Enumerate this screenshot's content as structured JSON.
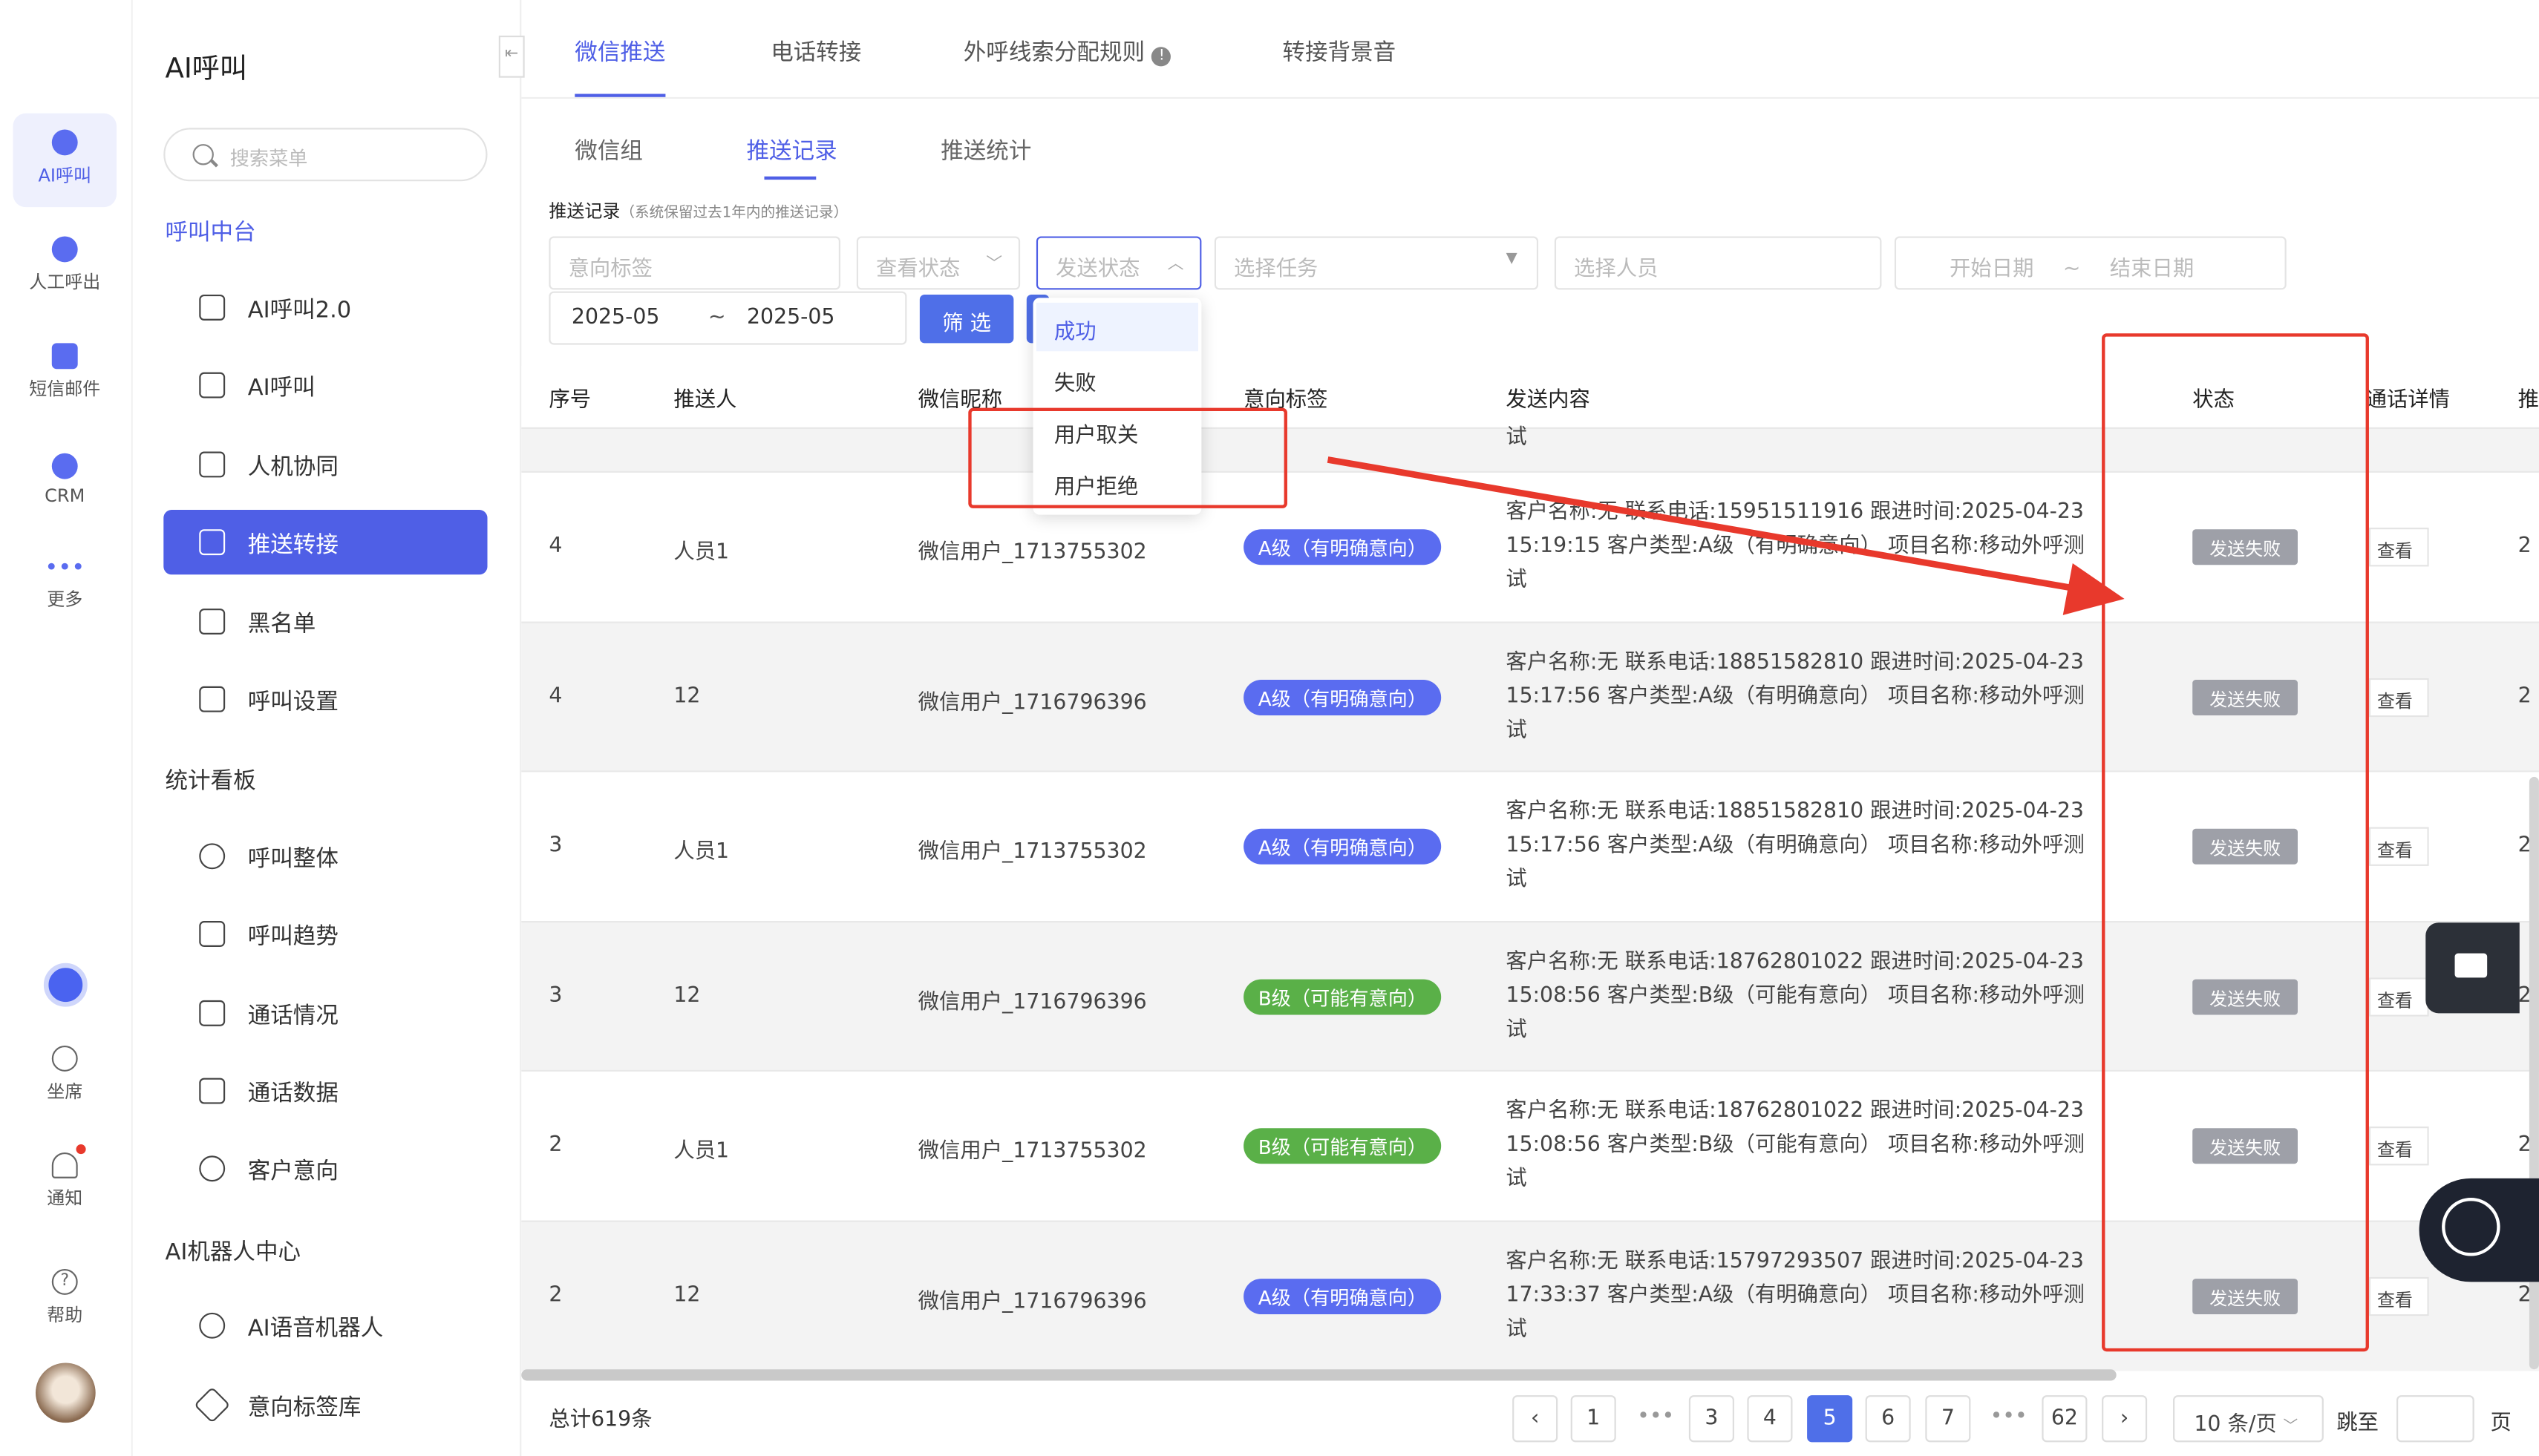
{
  "rail": {
    "items": [
      {
        "label": "AI呼叫",
        "icon": "ai-robot-icon"
      },
      {
        "label": "人工呼出",
        "icon": "headset-icon"
      },
      {
        "label": "短信邮件",
        "icon": "message-icon"
      },
      {
        "label": "CRM",
        "icon": "crm-icon"
      },
      {
        "label": "更多",
        "icon": "more-icon"
      }
    ],
    "bottom": [
      {
        "label": "坐席",
        "icon": "seat-headset-icon"
      },
      {
        "label": "通知",
        "icon": "bell-icon"
      },
      {
        "label": "帮助",
        "icon": "help-icon"
      }
    ]
  },
  "menu": {
    "title": "AI呼叫",
    "search_placeholder": "搜索菜单",
    "section1": "呼叫中台",
    "items1": [
      "AI呼叫2.0",
      "AI呼叫",
      "人机协同",
      "推送转接",
      "黑名单",
      "呼叫设置"
    ],
    "section2": "统计看板",
    "items2": [
      "呼叫整体",
      "呼叫趋势",
      "通话情况",
      "通话数据",
      "客户意向"
    ],
    "section3": "AI机器人中心",
    "items3": [
      "AI语音机器人",
      "意向标签库"
    ]
  },
  "tabs": [
    "微信推送",
    "电话转接",
    "外呼线索分配规则",
    "转接背景音"
  ],
  "subtabs": [
    "微信组",
    "推送记录",
    "推送统计"
  ],
  "section_title": "推送记录",
  "section_note": "（系统保留过去1年内的推送记录）",
  "filters": {
    "intent": "意向标签",
    "view_status": "查看状态",
    "send_status": "发送状态",
    "task": "选择任务",
    "person": "选择人员",
    "start_date": "开始日期",
    "tilde": "~",
    "end_date": "结束日期",
    "month_from": "2025-05",
    "month_to": "2025-05",
    "filter_btn": "筛 选"
  },
  "dropdown": [
    "成功",
    "失败",
    "用户取关",
    "用户拒绝"
  ],
  "columns": [
    "序号",
    "推送人",
    "微信昵称",
    "意向标签",
    "发送内容",
    "状态",
    "通话详情",
    "推"
  ],
  "top_partial": "试",
  "rows": [
    {
      "idx": "4",
      "pusher": "人员1",
      "nick": "微信用户_1713755302",
      "tag": "A级（有明确意向）",
      "tag_color": "#5a6cf0",
      "line1": "客户名称:无 联系电话:15951511916 跟进时间:2025-04-23",
      "line2": "15:19:15 客户类型:A级（有明确意向） 项目名称:移动外呼测",
      "line3": "试",
      "status": "发送失败",
      "look": "查看",
      "trail": "2"
    },
    {
      "idx": "4",
      "pusher": "12",
      "nick": "微信用户_1716796396",
      "tag": "A级（有明确意向）",
      "tag_color": "#5a6cf0",
      "line1": "客户名称:无 联系电话:18851582810 跟进时间:2025-04-23",
      "line2": "15:17:56 客户类型:A级（有明确意向） 项目名称:移动外呼测",
      "line3": "试",
      "status": "发送失败",
      "look": "查看",
      "trail": "2"
    },
    {
      "idx": "3",
      "pusher": "人员1",
      "nick": "微信用户_1713755302",
      "tag": "A级（有明确意向）",
      "tag_color": "#5a6cf0",
      "line1": "客户名称:无 联系电话:18851582810 跟进时间:2025-04-23",
      "line2": "15:17:56 客户类型:A级（有明确意向） 项目名称:移动外呼测",
      "line3": "试",
      "status": "发送失败",
      "look": "查看",
      "trail": "2"
    },
    {
      "idx": "3",
      "pusher": "12",
      "nick": "微信用户_1716796396",
      "tag": "B级（可能有意向）",
      "tag_color": "#5ab048",
      "line1": "客户名称:无 联系电话:18762801022 跟进时间:2025-04-23",
      "line2": "15:08:56 客户类型:B级（可能有意向） 项目名称:移动外呼测",
      "line3": "试",
      "status": "发送失败",
      "look": "查看",
      "trail": "2"
    },
    {
      "idx": "2",
      "pusher": "人员1",
      "nick": "微信用户_1713755302",
      "tag": "B级（可能有意向）",
      "tag_color": "#5ab048",
      "line1": "客户名称:无 联系电话:18762801022 跟进时间:2025-04-23",
      "line2": "15:08:56 客户类型:B级（可能有意向） 项目名称:移动外呼测",
      "line3": "试",
      "status": "发送失败",
      "look": "查看",
      "trail": "2"
    },
    {
      "idx": "2",
      "pusher": "12",
      "nick": "微信用户_1716796396",
      "tag": "A级（有明确意向）",
      "tag_color": "#5a6cf0",
      "line1": "客户名称:无 联系电话:15797293507 跟进时间:2025-04-23",
      "line2": "17:33:37 客户类型:A级（有明确意向） 项目名称:移动外呼测",
      "line3": "试",
      "status": "发送失败",
      "look": "查看",
      "trail": "2"
    }
  ],
  "footer": {
    "total": "总计619条",
    "pages": [
      "1",
      "3",
      "4",
      "5",
      "6",
      "7",
      "62"
    ],
    "dots": "•••",
    "current": "5",
    "page_size": "10 条/页",
    "jump": "跳至",
    "page_unit": "页"
  },
  "colors": {
    "accent": "#4f5fe6",
    "annotation": "#e8392c",
    "tag_a": "#5a6cf0",
    "tag_b": "#5ab048"
  }
}
